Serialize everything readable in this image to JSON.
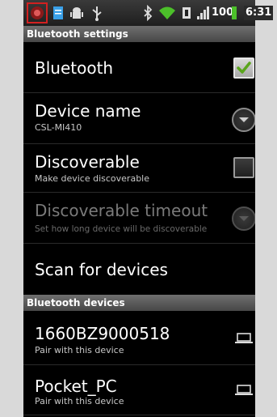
{
  "status_bar": {
    "battery_level": "100",
    "time": "6:31",
    "icons": [
      "app-notification-icon",
      "document-icon",
      "android-debug-icon",
      "usb-icon",
      "bluetooth-icon",
      "wifi-icon",
      "nfc-icon",
      "signal-icon",
      "battery-icon"
    ]
  },
  "bluetooth_settings_header": "Bluetooth settings",
  "bluetooth": {
    "title": "Bluetooth",
    "checked": true
  },
  "device_name": {
    "title": "Device name",
    "summary": "CSL-MI410"
  },
  "discoverable": {
    "title": "Discoverable",
    "summary": "Make device discoverable",
    "checked": false
  },
  "discoverable_timeout": {
    "title": "Discoverable timeout",
    "summary": "Set how long device will be discoverable",
    "enabled": false
  },
  "scan": {
    "title": "Scan for devices"
  },
  "bluetooth_devices_header": "Bluetooth devices",
  "devices": [
    {
      "name": "1660BZ9000518",
      "summary": "Pair with this device",
      "icon": "laptop-icon"
    },
    {
      "name": "Pocket_PC",
      "summary": "Pair with this device",
      "icon": "laptop-icon"
    }
  ],
  "colors": {
    "checkmark": "#5aa51c",
    "highlight_box": "#d22020"
  }
}
